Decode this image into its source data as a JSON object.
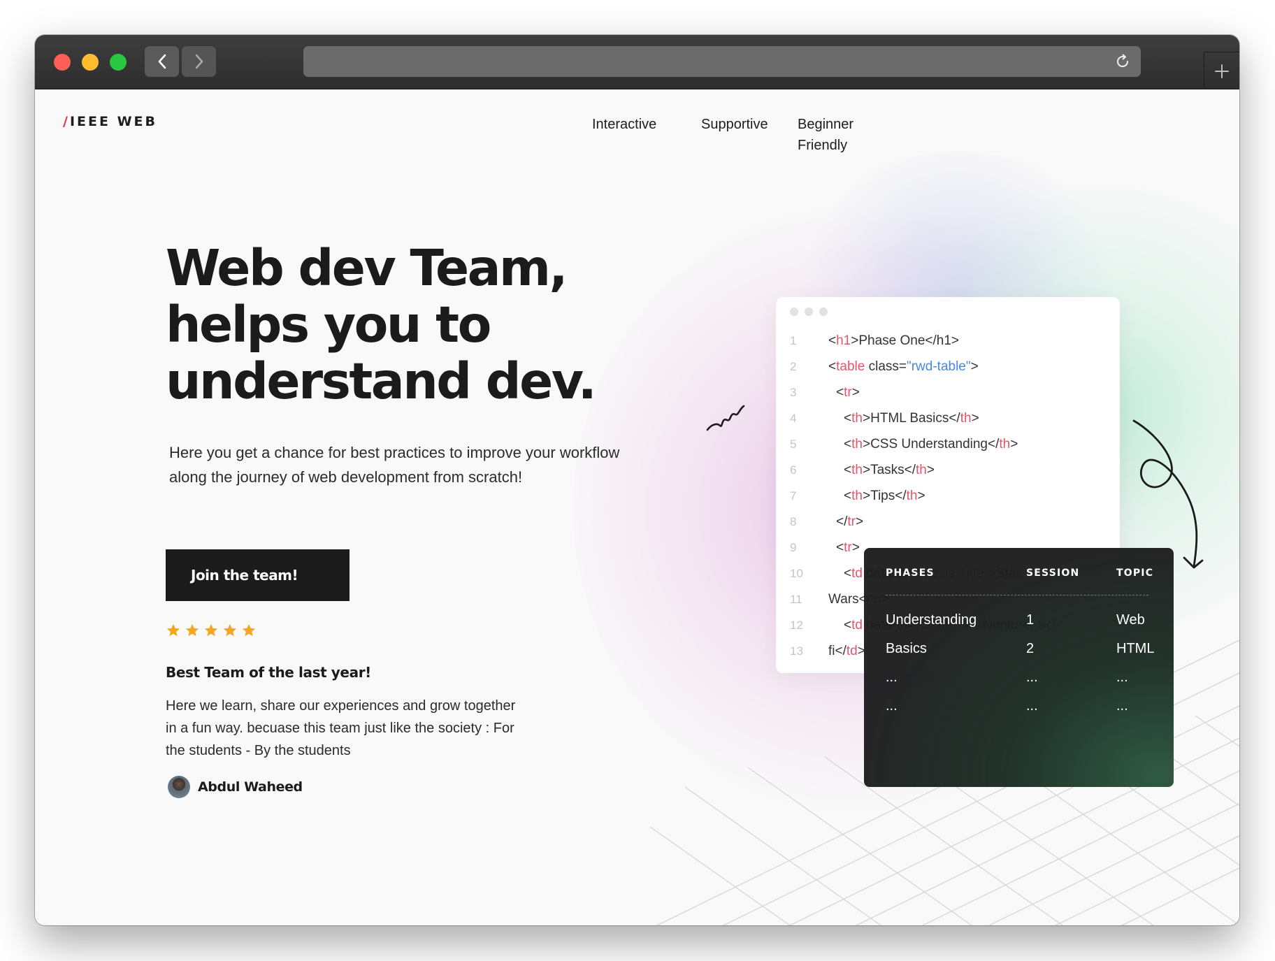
{
  "browser": {
    "url": ""
  },
  "site": {
    "logo_slash": "/",
    "logo_text": "IEEE WEB",
    "nav": [
      "Interactive",
      "Supportive",
      "Beginner Friendly"
    ]
  },
  "hero": {
    "title": "Web dev Team, helps you to understand dev.",
    "subtitle": "Here you get a chance for best practices to improve your workflow along the journey of web development from scratch!",
    "cta_label": "Join the team!"
  },
  "testimonial": {
    "rating": 5,
    "title": "Best Team of the last year!",
    "body": "Here we learn, share our experiences and grow together in a fun way. becuase this team just like the society : For the students - By the students",
    "author": "Abdul Waheed"
  },
  "code_card": {
    "line_numbers": [
      "1",
      "2",
      "3",
      "4",
      "5",
      "6",
      "7",
      "8",
      "9",
      "10",
      "11",
      "12",
      "13"
    ],
    "lines": [
      "<h1>Phase One</h1>",
      "<table class=\"rwd-table\">",
      "<tr>",
      "<th>HTML Basics</th>",
      "<th>CSS Understanding</th>",
      "<th>Tasks</th>",
      "<th>Tips</th>",
      "</tr>",
      "<tr>",
      "<td data-th=\"Movie Title\">Star",
      "Wars</td>",
      "<td data-th=\"Genre\">Adventure, Sci-",
      "fi</td>"
    ]
  },
  "table_card": {
    "headers": [
      "PHASES",
      "SESSION",
      "TOPIC"
    ],
    "rows": [
      [
        "Understanding",
        "1",
        "Web"
      ],
      [
        "Basics",
        "2",
        "HTML"
      ],
      [
        "...",
        "...",
        "..."
      ],
      [
        "...",
        "...",
        "..."
      ]
    ]
  },
  "colors": {
    "accent": "#e5323e",
    "dark": "#1b1b1c",
    "star": "#f4a623",
    "code_tag": "#e2556b",
    "code_value": "#4a86d9"
  },
  "icons": [
    "back-arrow-icon",
    "forward-arrow-icon",
    "reload-icon",
    "plus-icon",
    "star-icon",
    "avatar"
  ]
}
